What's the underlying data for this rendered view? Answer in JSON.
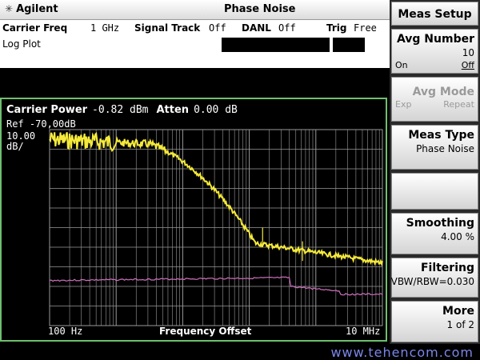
{
  "titlebar": {
    "brand": "Agilent",
    "title": "Phase Noise"
  },
  "status": {
    "carrier_freq_label": "Carrier Freq",
    "carrier_freq_value": "1 GHz",
    "signal_track_label": "Signal Track",
    "signal_track_value": "Off",
    "danl_label": "DANL",
    "danl_value": "Off",
    "trig_label": "Trig",
    "trig_value": "Free",
    "plot_mode": "Log Plot"
  },
  "graph": {
    "carrier_power_label": "Carrier Power",
    "carrier_power_value": "-0.82 dBm",
    "atten_label": "Atten",
    "atten_value": "0.00 dB",
    "ref_text": "Ref -70,00dB",
    "scale_value": "10.00",
    "scale_unit": "dB/",
    "x_start": "100 Hz",
    "x_label": "Frequency Offset",
    "x_stop": "10 MHz",
    "trace_color": "#f5ea3a",
    "ref_trace_color": "#d070c0",
    "grid_color": "#9a9a9a"
  },
  "softkeys": {
    "menu_title": "Meas Setup",
    "avg_number_label": "Avg Number",
    "avg_number_value": "10",
    "avg_number_on": "On",
    "avg_number_off": "Off",
    "avg_mode_label": "Avg Mode",
    "avg_mode_exp": "Exp",
    "avg_mode_repeat": "Repeat",
    "meas_type_label": "Meas Type",
    "meas_type_value": "Phase Noise",
    "smoothing_label": "Smoothing",
    "smoothing_value": "4.00 %",
    "filtering_label": "Filtering",
    "filtering_value": "VBW/RBW=0.030",
    "more_label": "More",
    "more_value": "1 of 2"
  },
  "watermark": "www.tehencom.com"
}
